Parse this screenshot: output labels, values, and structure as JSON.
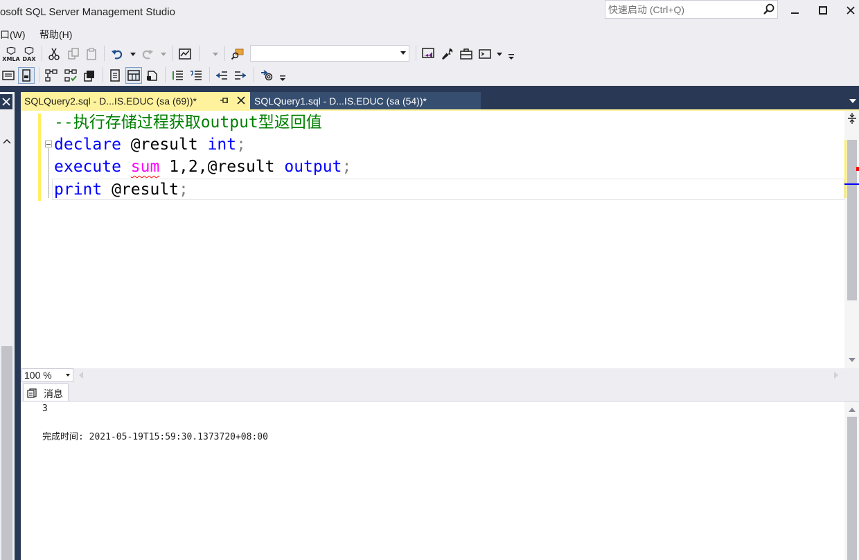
{
  "window": {
    "title": "osoft SQL Server Management Studio",
    "quick_launch_placeholder": "快速启动 (Ctrl+Q)"
  },
  "menu": {
    "window_label": "口(W)",
    "help_label": "帮助(H)"
  },
  "toolbar": {
    "xmla_label": "XMLA",
    "dax_label": "DAX",
    "database_combo_value": ""
  },
  "tabs": [
    {
      "label": "SQLQuery2.sql - D...IS.EDUC (sa (69))*",
      "active": true
    },
    {
      "label": "SQLQuery1.sql - D...IS.EDUC (sa (54))*",
      "active": false
    }
  ],
  "editor": {
    "line1_comment": "--执行存储过程获取output型返回值",
    "line2": {
      "kw": "declare",
      "var": " @result ",
      "type": "int",
      "end": ";"
    },
    "line3": {
      "kw": "execute",
      "fn": "sum",
      "args": " 1,2,@result ",
      "kw2": "output",
      "end": ";"
    },
    "line4": {
      "kw": "print",
      "var": " @result",
      "end": ";"
    }
  },
  "zoom": {
    "value": "100 %"
  },
  "results": {
    "tab_label": "消息",
    "lines": [
      "3",
      "完成时间: 2021-05-19T15:59:30.1373720+08:00"
    ]
  },
  "colors": {
    "keyword": "#0000ff",
    "comment": "#008000",
    "function": "#ff00ff",
    "active_tab": "#fff29d",
    "doc_well": "#293955"
  }
}
